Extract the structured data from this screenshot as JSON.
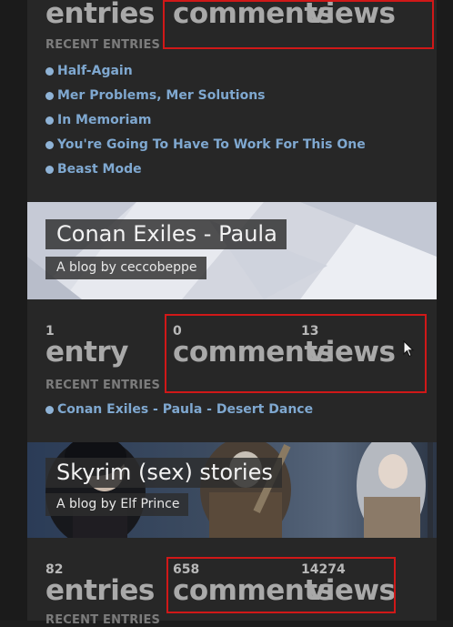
{
  "blog1": {
    "entries_label": "entries",
    "comments_label": "comments",
    "views_label": "views",
    "recent_header": "RECENT ENTRIES",
    "recent": [
      "Half-Again",
      "Mer Problems, Mer Solutions",
      "In Memoriam",
      "You're Going To Have To Work For This One",
      "Beast Mode"
    ]
  },
  "blog2": {
    "title": "Conan Exiles - Paula",
    "byline": "A blog by ceccobeppe",
    "entries_count": "1",
    "entries_label": "entry",
    "comments_count": "0",
    "comments_label": "comments",
    "views_count": "13",
    "views_label": "views",
    "recent_header": "RECENT ENTRIES",
    "recent": [
      "Conan Exiles - Paula - Desert Dance"
    ]
  },
  "blog3": {
    "title": "Skyrim (sex) stories",
    "byline": "A blog by Elf Prince",
    "entries_count": "82",
    "entries_label": "entries",
    "comments_count": "658",
    "comments_label": "comments",
    "views_count": "14274",
    "views_label": "views",
    "recent_header": "RECENT ENTRIES"
  },
  "colors": {
    "background": "#272727",
    "link": "#7fa8d0",
    "highlight_box": "#d01818",
    "stat_text": "#a9a9a9"
  }
}
